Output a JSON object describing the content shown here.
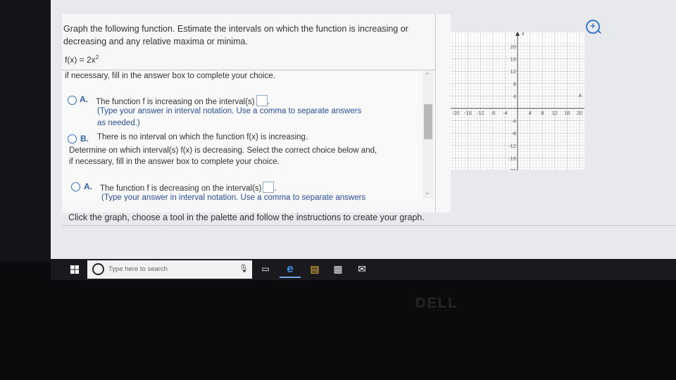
{
  "question": {
    "line1": "Graph the following function. Estimate the intervals on which the function is increasing or",
    "line2": "decreasing and any relative maxima or minima.",
    "function_label": "f(x) = 2x",
    "function_exp": "2"
  },
  "scroll": {
    "instruction_top": "if necessary, fill in the answer box to complete your choice.",
    "inc_A_letter": "A.",
    "inc_A_text": "The function f is increasing on the interval(s)",
    "inc_A_hint1": "(Type your answer in interval notation. Use a comma to separate answers",
    "inc_A_hint2": "as needed.)",
    "inc_B_letter": "B.",
    "inc_B_text": "There is no interval on which the function f(x) is increasing.",
    "dec_prompt1": "Determine on which interval(s) f(x) is decreasing. Select the correct choice below and,",
    "dec_prompt2": "if necessary, fill in the answer box to complete your choice.",
    "dec_A_letter": "A.",
    "dec_A_text": "The function f is decreasing on the interval(s)",
    "dec_A_hint1": "(Type your answer in interval notation. Use a comma to separate answers"
  },
  "footer": "Click the graph, choose a tool in the palette and follow the instructions to create your graph.",
  "graph": {
    "x_axis_label": "x",
    "y_axis_label": "y",
    "x_ticks": [
      "-20",
      "-16",
      "-12",
      "-8",
      "-4",
      "4",
      "8",
      "12",
      "16",
      "20"
    ],
    "y_ticks": [
      "20",
      "16",
      "12",
      "8",
      "4",
      "-4",
      "-8",
      "-12",
      "-16",
      "-20"
    ]
  },
  "taskbar": {
    "search_placeholder": "Type here to search"
  },
  "colors": {
    "accent": "#2f6fbf",
    "grid": "#cfcfd3"
  }
}
